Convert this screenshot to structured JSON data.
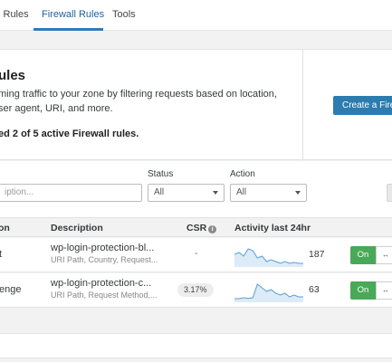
{
  "tabs": [
    {
      "label": "l Rules"
    },
    {
      "label": "Firewall Rules"
    },
    {
      "label": "Tools"
    }
  ],
  "intro": {
    "title": "ules",
    "desc_line1": "ming traffic to your zone by filtering requests based on location,",
    "desc_line2": "ser agent, URI, and more.",
    "count_text": "ed 2 of 5 active Firewall rules.",
    "create_button": "Create a Firewall rule"
  },
  "filters": {
    "search_placeholder": "iption...",
    "status_label": "Status",
    "status_value": "All",
    "action_label": "Action",
    "action_value": "All"
  },
  "table": {
    "headers": {
      "action": "on",
      "description": "Description",
      "csr": "CSR",
      "activity": "Activity last 24hr"
    },
    "rows": [
      {
        "action": "t",
        "description": "wp-login-protection-bl...",
        "sub": "URI Path, Country, Request...",
        "csr": "-",
        "activity_count": "187",
        "toggle_on": "On",
        "toggle_off_icon": "↔",
        "sparkline": [
          6,
          7,
          5,
          9,
          8,
          4,
          5,
          2,
          3,
          2,
          1,
          2,
          1,
          1.5,
          1,
          1
        ]
      },
      {
        "action": "enge",
        "description": "wp-login-protection-c...",
        "sub": "URI Path, Request Method,...",
        "csr": "3.17%",
        "activity_count": "63",
        "toggle_on": "On",
        "toggle_off_icon": "↔",
        "sparkline": [
          1,
          1,
          1.5,
          1.2,
          1.5,
          9,
          7,
          5,
          6,
          4,
          3,
          4,
          2,
          3,
          2,
          2
        ]
      }
    ]
  },
  "colors": {
    "accent": "#2c7cb0",
    "toggle_on": "#4aa859",
    "sparkline_stroke": "#5a9fd6",
    "sparkline_fill": "#dcebf7"
  }
}
